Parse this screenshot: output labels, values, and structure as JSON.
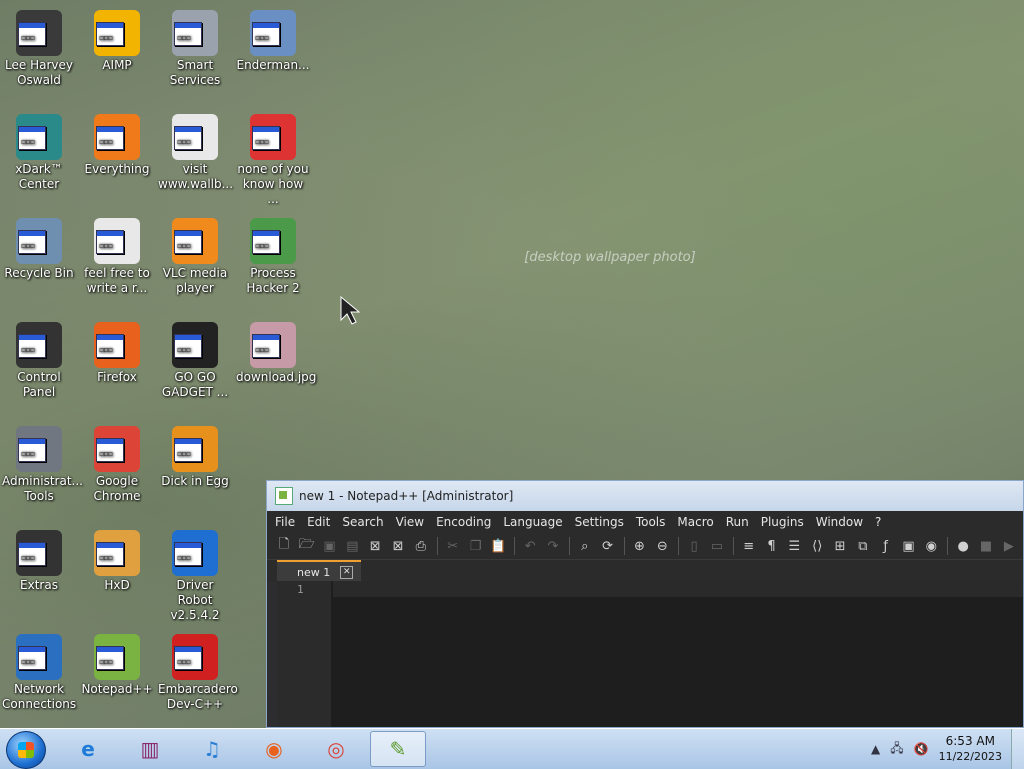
{
  "wallpaper": {
    "note": "[desktop wallpaper photo]"
  },
  "desktop_icons": [
    {
      "label": "Lee Harvey Oswald",
      "icon": "character-icon",
      "color": "#3a3a3a"
    },
    {
      "label": "AIMP",
      "icon": "aimp-icon",
      "color": "#f2b400"
    },
    {
      "label": "Smart Services",
      "icon": "gears-icon",
      "color": "#9aa3ad"
    },
    {
      "label": "Enderman...",
      "icon": "app-window-icon",
      "color": "#6a8fc2"
    },
    {
      "label": "xDark™ Center",
      "icon": "xdark-icon",
      "color": "#2a8a8a"
    },
    {
      "label": "Everything",
      "icon": "everything-icon",
      "color": "#f07a1a"
    },
    {
      "label": "visit www.wallb...",
      "icon": "text-document-icon",
      "color": "#e8e8e8"
    },
    {
      "label": "none of you know how ...",
      "icon": "app-window-icon",
      "color": "#d33"
    },
    {
      "label": "Recycle Bin",
      "icon": "recycle-bin-icon",
      "color": "#6f8fb0"
    },
    {
      "label": "feel free to write a r...",
      "icon": "text-document-icon",
      "color": "#e8e8e8"
    },
    {
      "label": "VLC media player",
      "icon": "vlc-icon",
      "color": "#f08a1c"
    },
    {
      "label": "Process Hacker 2",
      "icon": "process-hacker-icon",
      "color": "#4a9a4a"
    },
    {
      "label": "Control Panel",
      "icon": "control-panel-icon",
      "color": "#333"
    },
    {
      "label": "Firefox",
      "icon": "firefox-icon",
      "color": "#e8621d"
    },
    {
      "label": "GO GO GADGET ...",
      "icon": "gadget-icon",
      "color": "#222"
    },
    {
      "label": "download.jpg",
      "icon": "image-file-icon",
      "color": "#c79aa8"
    },
    {
      "label": "Administrat... Tools",
      "icon": "admin-tools-icon",
      "color": "#707780"
    },
    {
      "label": "Google Chrome",
      "icon": "chrome-icon",
      "color": "#db4437"
    },
    {
      "label": "Dick in Egg",
      "icon": "app-e-icon",
      "color": "#e8901c"
    },
    {
      "label": "Extras",
      "icon": "folder-dark-icon",
      "color": "#333"
    },
    {
      "label": "HxD",
      "icon": "hxd-icon",
      "color": "#e0a040"
    },
    {
      "label": "Driver Robot v2.5.4.2",
      "icon": "driver-robot-icon",
      "color": "#1e6fd1"
    },
    {
      "label": "Network Connections",
      "icon": "network-icon",
      "color": "#2a6fc0"
    },
    {
      "label": "Notepad++",
      "icon": "notepadpp-icon",
      "color": "#7bb342"
    },
    {
      "label": "Embarcadero Dev-C++",
      "icon": "devcpp-icon",
      "color": "#d02020"
    }
  ],
  "notepad": {
    "title": "new 1 - Notepad++ [Administrator]",
    "menus": [
      "File",
      "Edit",
      "Search",
      "View",
      "Encoding",
      "Language",
      "Settings",
      "Tools",
      "Macro",
      "Run",
      "Plugins",
      "Window",
      "?"
    ],
    "tab_label": "new 1",
    "line_number": "1"
  },
  "taskbar": {
    "apps": [
      {
        "name": "internet-explorer-icon"
      },
      {
        "name": "winrar-icon"
      },
      {
        "name": "itunes-icon"
      },
      {
        "name": "firefox-icon"
      },
      {
        "name": "chrome-icon"
      },
      {
        "name": "notepadpp-icon",
        "active": true
      }
    ],
    "time": "6:53 AM",
    "date": "11/22/2023"
  }
}
